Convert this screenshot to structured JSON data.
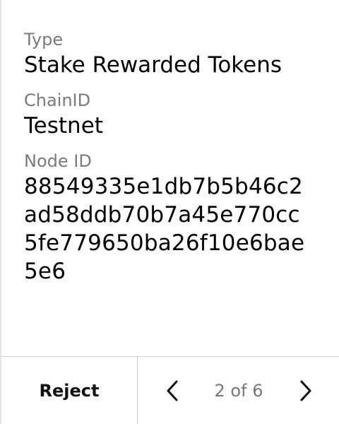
{
  "fields": [
    {
      "label": "Type",
      "value": "Stake Rewarded Tokens"
    },
    {
      "label": "ChainID",
      "value": "Testnet"
    },
    {
      "label": "Node ID",
      "value": "88549335e1db7b5b46c2ad58ddb70b7a45e770cc5fe779650ba26f10e6bae5e6"
    }
  ],
  "footer": {
    "reject_label": "Reject",
    "page_indicator": "2 of 6",
    "prev_icon": "chevron-left-icon",
    "next_icon": "chevron-right-icon"
  }
}
